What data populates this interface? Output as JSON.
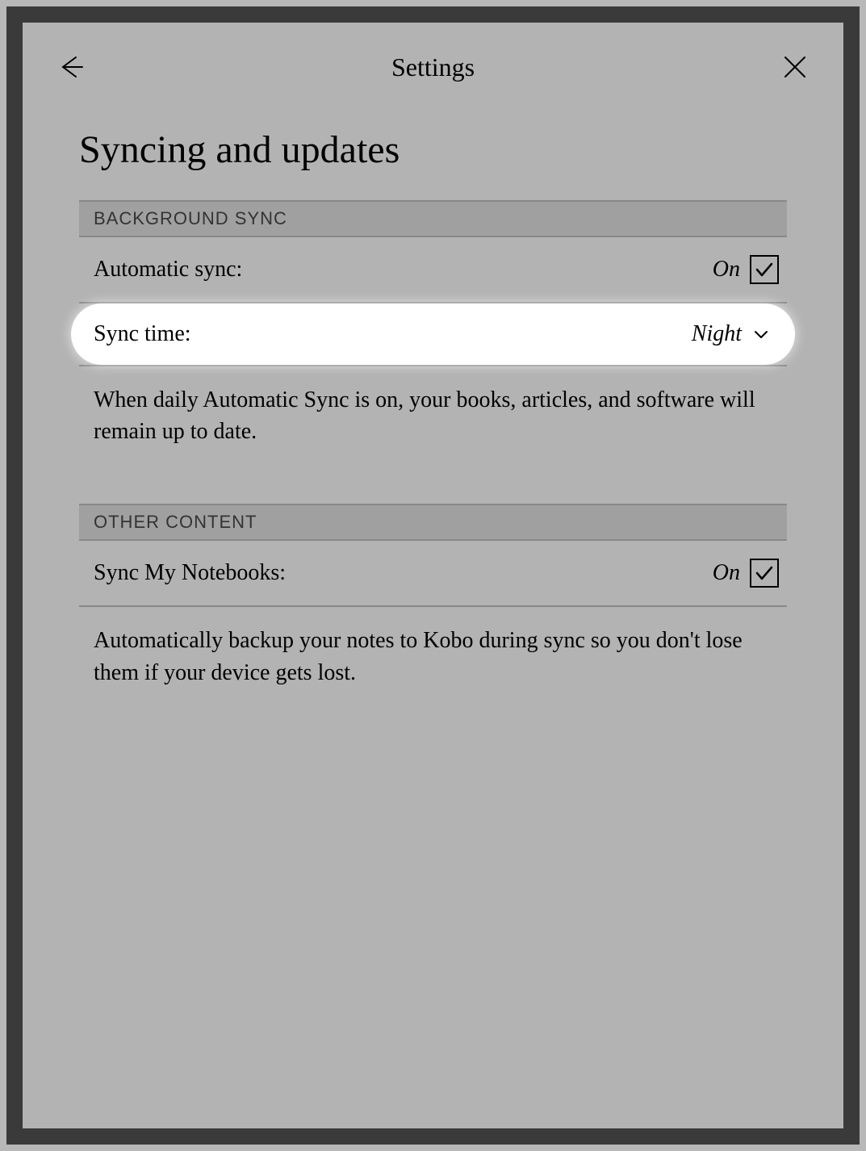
{
  "header": {
    "title": "Settings"
  },
  "page": {
    "title": "Syncing and updates"
  },
  "sections": {
    "background_sync": {
      "header": "BACKGROUND SYNC",
      "automatic_sync": {
        "label": "Automatic sync:",
        "value": "On"
      },
      "sync_time": {
        "label": "Sync time:",
        "value": "Night"
      },
      "description": "When daily Automatic Sync is on, your books, articles, and software will remain up to date."
    },
    "other_content": {
      "header": "OTHER CONTENT",
      "sync_notebooks": {
        "label": "Sync My Notebooks:",
        "value": "On"
      },
      "description": "Automatically backup your notes to Kobo during sync so you don't lose them if your device gets lost."
    }
  }
}
